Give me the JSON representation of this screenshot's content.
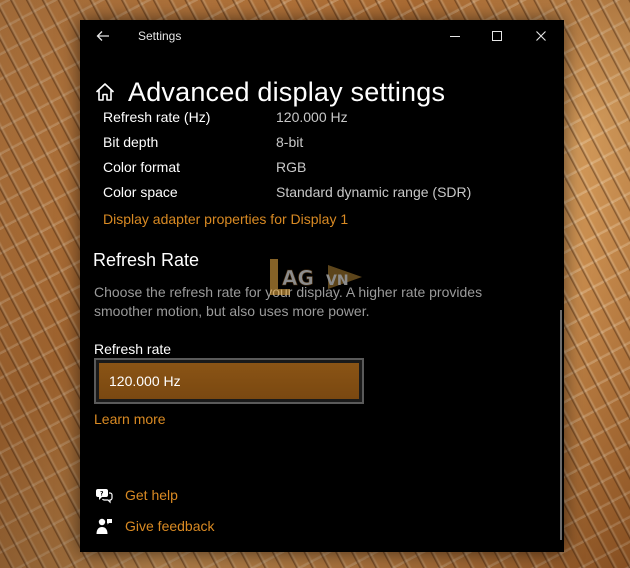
{
  "window": {
    "title": "Settings"
  },
  "page": {
    "title": "Advanced display settings"
  },
  "display_info": [
    {
      "label": "Refresh rate (Hz)",
      "value": "120.000 Hz"
    },
    {
      "label": "Bit depth",
      "value": "8-bit"
    },
    {
      "label": "Color format",
      "value": "RGB"
    },
    {
      "label": "Color space",
      "value": "Standard dynamic range (SDR)"
    }
  ],
  "adapter_link": "Display adapter properties for Display 1",
  "refresh_section": {
    "title": "Refresh Rate",
    "description": "Choose the refresh rate for your display. A higher rate provides smoother motion, but also uses more power.",
    "field_label": "Refresh rate",
    "selected_value": "120.000 Hz",
    "learn_more": "Learn more"
  },
  "help": {
    "get_help": "Get help",
    "give_feedback": "Give feedback"
  },
  "watermark_text": "LAG.VN",
  "colors": {
    "accent": "#d98a23",
    "select_fill": "#7a4811",
    "background": "#000000"
  },
  "icons": [
    "back-arrow-icon",
    "minimize-icon",
    "maximize-icon",
    "close-icon",
    "home-icon",
    "get-help-icon",
    "feedback-icon"
  ]
}
